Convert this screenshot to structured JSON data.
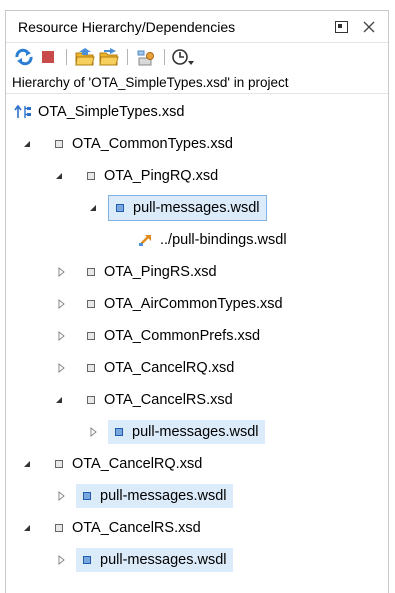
{
  "panel": {
    "title": "Resource Hierarchy/Dependencies",
    "subheader": "Hierarchy of 'OTA_SimpleTypes.xsd' in project"
  },
  "toolbar": {
    "icons": [
      "refresh-icon",
      "stop-icon",
      "show-hierarchy-icon",
      "show-dependencies-icon",
      "configure-icon",
      "history-icon"
    ]
  },
  "tree": {
    "root": "OTA_SimpleTypes.xsd",
    "rows": [
      {
        "label": "OTA_CommonTypes.xsd"
      },
      {
        "label": "OTA_PingRQ.xsd"
      },
      {
        "label": "pull-messages.wsdl"
      },
      {
        "label": "../pull-bindings.wsdl"
      },
      {
        "label": "OTA_PingRS.xsd"
      },
      {
        "label": "OTA_AirCommonTypes.xsd"
      },
      {
        "label": "OTA_CommonPrefs.xsd"
      },
      {
        "label": "OTA_CancelRQ.xsd"
      },
      {
        "label": "OTA_CancelRS.xsd"
      },
      {
        "label": "pull-messages.wsdl"
      },
      {
        "label": "OTA_CancelRQ.xsd"
      },
      {
        "label": "pull-messages.wsdl"
      },
      {
        "label": "OTA_CancelRS.xsd"
      },
      {
        "label": "pull-messages.wsdl"
      }
    ]
  },
  "colors": {
    "selection": "#dcebfa",
    "selection_border": "#7fb2e5",
    "wsdl_square": "#7aa7dd"
  }
}
